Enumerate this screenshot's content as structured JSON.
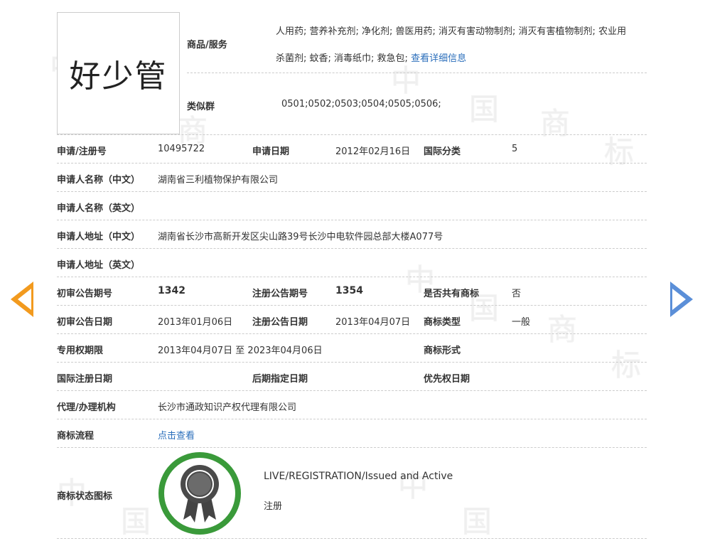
{
  "trademark": {
    "name": "好少管"
  },
  "goods": {
    "label": "商品/服务",
    "line1": "人用药; 营养补充剂; 净化剂; 兽医用药; 消灭有害动物制剂; 消灭有害植物制剂; 农业用",
    "line2": "杀菌剂; 蚊香; 消毒纸巾; 救急包;",
    "detail_link": "查看详细信息"
  },
  "similar_group": {
    "label": "类似群",
    "value": "0501;0502;0503;0504;0505;0506;"
  },
  "rows": {
    "reg_no": {
      "label": "申请/注册号",
      "value": "10495722"
    },
    "app_date": {
      "label": "申请日期",
      "value": "2012年02月16日"
    },
    "intl_class": {
      "label": "国际分类",
      "value": "5"
    },
    "applicant_cn": {
      "label": "申请人名称（中文）",
      "value": "湖南省三利植物保护有限公司"
    },
    "applicant_en": {
      "label": "申请人名称（英文）",
      "value": ""
    },
    "address_cn": {
      "label": "申请人地址（中文）",
      "value": "湖南省长沙市高新开发区尖山路39号长沙中电软件园总部大楼A077号"
    },
    "address_en": {
      "label": "申请人地址（英文）",
      "value": ""
    },
    "prelim_issue": {
      "label": "初审公告期号",
      "value": "1342"
    },
    "reg_issue": {
      "label": "注册公告期号",
      "value": "1354"
    },
    "shared": {
      "label": "是否共有商标",
      "value": "否"
    },
    "prelim_date": {
      "label": "初审公告日期",
      "value": "2013年01月06日"
    },
    "reg_date": {
      "label": "注册公告日期",
      "value": "2013年04月07日"
    },
    "tm_type": {
      "label": "商标类型",
      "value": "一般"
    },
    "exclusive": {
      "label": "专用权期限",
      "value": "2013年04月07日 至 2023年04月06日"
    },
    "tm_form": {
      "label": "商标形式",
      "value": ""
    },
    "intl_reg_date": {
      "label": "国际注册日期",
      "value": ""
    },
    "later_date": {
      "label": "后期指定日期",
      "value": ""
    },
    "priority_date": {
      "label": "优先权日期",
      "value": ""
    },
    "agency": {
      "label": "代理/办理机构",
      "value": "长沙市通政知识产权代理有限公司"
    },
    "process": {
      "label": "商标流程",
      "value": "点击查看"
    },
    "status_icon": {
      "label": "商标状态图标",
      "status_en": "LIVE/REGISTRATION/Issued and Active",
      "status_cn": "注册"
    }
  },
  "watermark": [
    "中",
    "国",
    "商",
    "标"
  ],
  "colors": {
    "link": "#2a6ebb",
    "badge_green": "#3a9a3a",
    "prev_arrow": "#f29a1e",
    "next_arrow": "#5b8fd8"
  },
  "icons": {
    "prev": "arrow-left-icon",
    "next": "arrow-right-icon",
    "status": "award-ribbon-icon"
  }
}
